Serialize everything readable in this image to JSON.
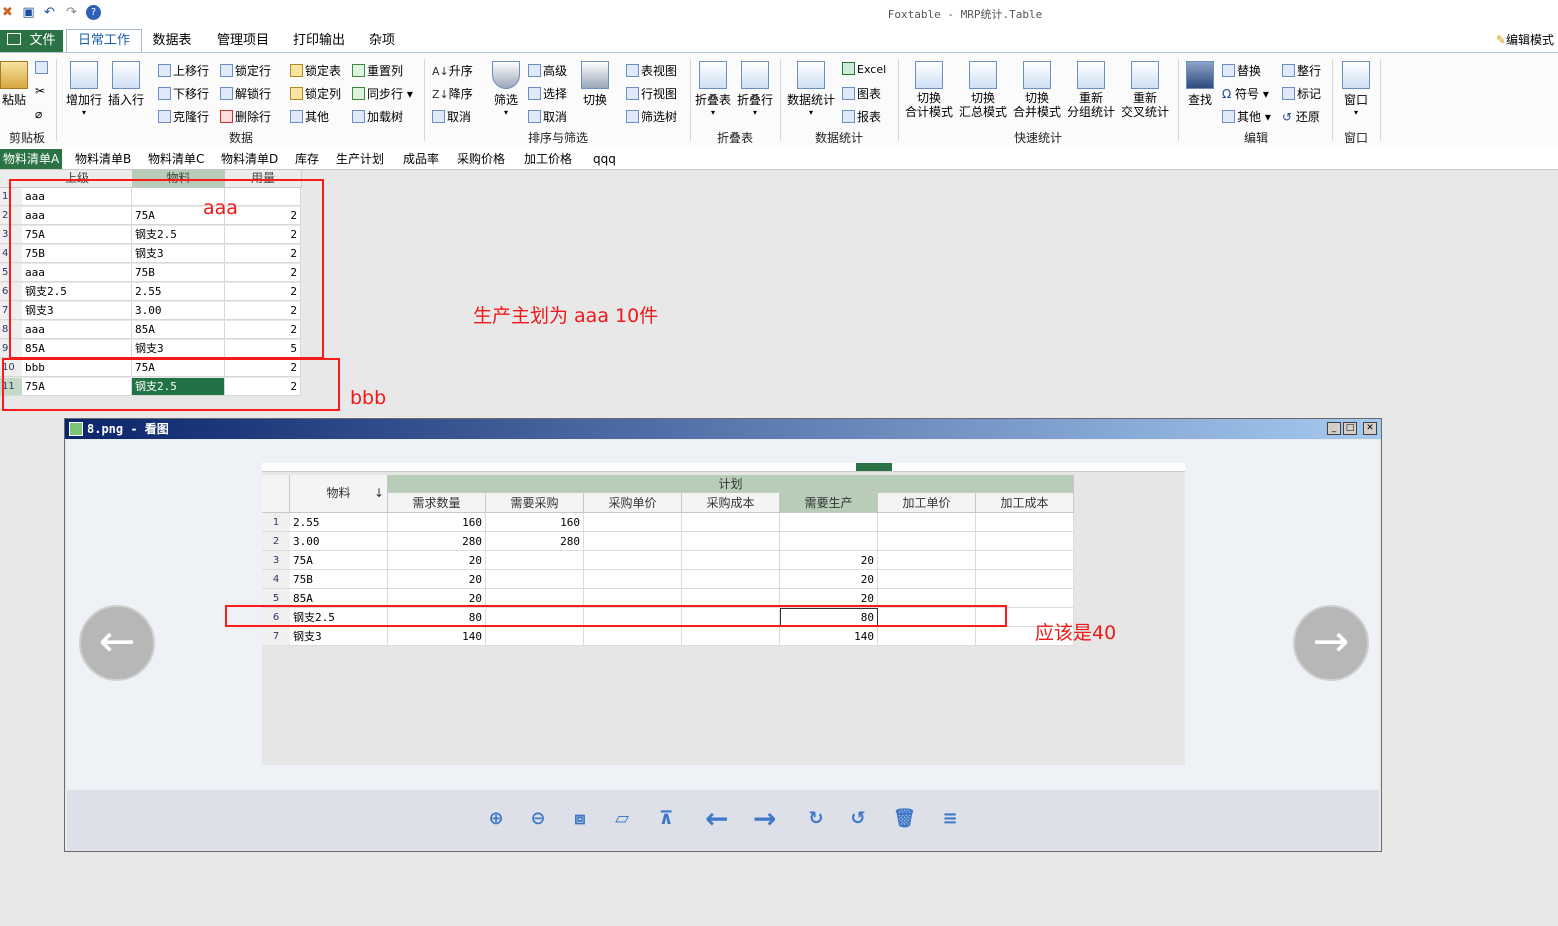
{
  "app": {
    "title": "Foxtable - MRP统计.Table",
    "edit_mode": "编辑模式"
  },
  "menu": {
    "tabs": [
      "文件",
      "日常工作",
      "数据表",
      "管理项目",
      "打印输出",
      "杂项"
    ]
  },
  "ribbon": {
    "groups": {
      "clipboard": "剪贴板",
      "data": "数据",
      "sort_filter": "排序与筛选",
      "fold": "折叠表",
      "stats": "数据统计",
      "quick": "快速统计",
      "edit": "编辑",
      "window": "窗口"
    },
    "buttons": {
      "paste": "粘贴",
      "add_row": "增加行",
      "insert_row": "插入行",
      "move_up": "上移行",
      "move_down": "下移行",
      "clone_row": "克隆行",
      "lock_row": "锁定行",
      "unlock_row": "解锁行",
      "delete_row": "删除行",
      "lock_table": "锁定表",
      "lock_col": "锁定列",
      "other": "其他",
      "reset_col": "重置列",
      "sync_col": "同步行",
      "load_tree": "加载树",
      "asc": "升序",
      "desc": "降序",
      "cancel_sort": "取消",
      "filter": "筛选",
      "advanced": "高级",
      "select": "选择",
      "cancel_filter": "取消",
      "toggle": "切换",
      "table_view": "表视图",
      "row_view": "行视图",
      "filter_tree": "筛选树",
      "fold_table": "折叠表",
      "fold_row": "折叠行",
      "data_stats": "数据统计",
      "excel": "Excel",
      "chart": "图表",
      "report": "报表",
      "q1a": "切换",
      "q1b": "合计模式",
      "q2a": "切换",
      "q2b": "汇总模式",
      "q3a": "切换",
      "q3b": "合并模式",
      "q4a": "重新",
      "q4b": "分组统计",
      "q5a": "重新",
      "q5b": "交叉统计",
      "find": "查找",
      "replace": "替换",
      "symbol": "符号",
      "other2": "其他",
      "whole_row": "整行",
      "mark": "标记",
      "restore": "还原",
      "window": "窗口"
    }
  },
  "sheet_tabs": [
    "物料清单A",
    "物料清单B",
    "物料清单C",
    "物料清单D",
    "库存",
    "生产计划",
    "成品率",
    "采购价格",
    "加工价格",
    "qqq"
  ],
  "grid": {
    "headers": [
      "上级",
      "物料",
      "用量"
    ],
    "rows": [
      {
        "n": "1",
        "parent": "aaa",
        "item": "",
        "qty": ""
      },
      {
        "n": "2",
        "parent": "aaa",
        "item": "75A",
        "qty": "2"
      },
      {
        "n": "3",
        "parent": "75A",
        "item": "钢支2.5",
        "qty": "2"
      },
      {
        "n": "4",
        "parent": "75B",
        "item": "钢支3",
        "qty": "2"
      },
      {
        "n": "5",
        "parent": "aaa",
        "item": "75B",
        "qty": "2"
      },
      {
        "n": "6",
        "parent": "钢支2.5",
        "item": "2.55",
        "qty": "2"
      },
      {
        "n": "7",
        "parent": "钢支3",
        "item": "3.00",
        "qty": "2"
      },
      {
        "n": "8",
        "parent": "aaa",
        "item": "85A",
        "qty": "2"
      },
      {
        "n": "9",
        "parent": "85A",
        "item": "钢支3",
        "qty": "5"
      },
      {
        "n": "10",
        "parent": "bbb",
        "item": "75A",
        "qty": "2"
      },
      {
        "n": "11",
        "parent": "75A",
        "item": "钢支2.5",
        "qty": "2"
      }
    ]
  },
  "annotations": {
    "box_a_label": "aaa",
    "box_b_label": "bbb",
    "plan_note": "生产主划为 aaa 10件",
    "should_be": "应该是40"
  },
  "viewer": {
    "title": "8.png - 看图",
    "inner": {
      "group_header": "计划",
      "col_item": "物料",
      "sort_mark": "↓",
      "columns": [
        "需求数量",
        "需要采购",
        "采购单价",
        "采购成本",
        "需要生产",
        "加工单价",
        "加工成本"
      ],
      "rows": [
        {
          "n": "1",
          "item": "2.55",
          "vals": [
            "160",
            "160",
            "",
            "",
            "",
            "",
            ""
          ]
        },
        {
          "n": "2",
          "item": "3.00",
          "vals": [
            "280",
            "280",
            "",
            "",
            "",
            "",
            ""
          ]
        },
        {
          "n": "3",
          "item": "75A",
          "vals": [
            "20",
            "",
            "",
            "",
            "20",
            "",
            ""
          ]
        },
        {
          "n": "4",
          "item": "75B",
          "vals": [
            "20",
            "",
            "",
            "",
            "20",
            "",
            ""
          ]
        },
        {
          "n": "5",
          "item": "85A",
          "vals": [
            "20",
            "",
            "",
            "",
            "20",
            "",
            ""
          ]
        },
        {
          "n": "6",
          "item": "钢支2.5",
          "vals": [
            "80",
            "",
            "",
            "",
            "80",
            "",
            ""
          ]
        },
        {
          "n": "7",
          "item": "钢支3",
          "vals": [
            "140",
            "",
            "",
            "",
            "140",
            "",
            ""
          ]
        }
      ]
    },
    "tools": [
      "zoom-in-icon",
      "zoom-out-icon",
      "fit-icon",
      "open-folder-icon",
      "slideshow-icon",
      "prev-icon",
      "next-icon",
      "rotate-cw-icon",
      "rotate-ccw-icon",
      "delete-icon",
      "menu-icon"
    ]
  },
  "colors": {
    "accent": "#2b7244",
    "annotation": "#ff1a1a"
  }
}
